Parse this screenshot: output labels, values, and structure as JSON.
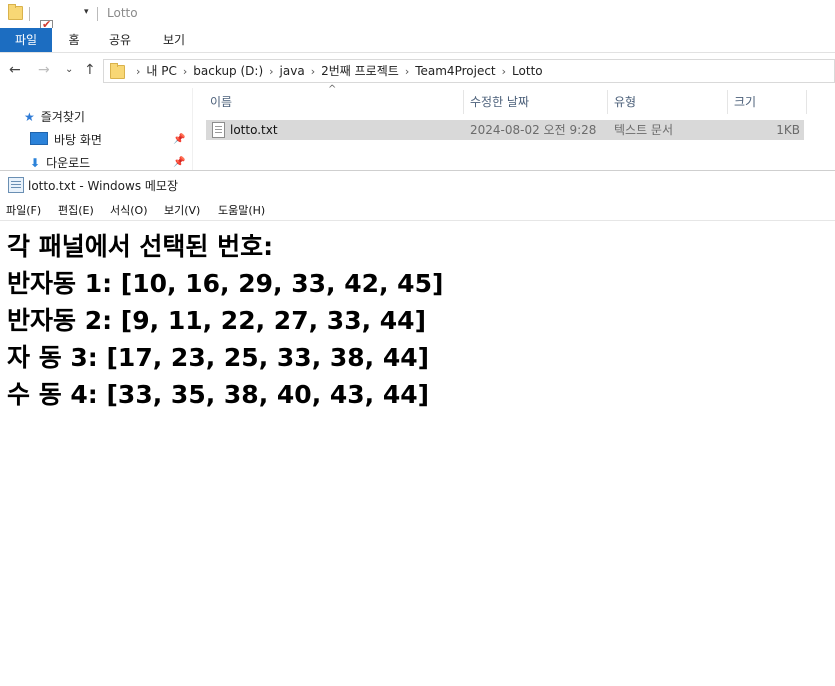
{
  "explorer": {
    "window_title": "Lotto",
    "ribbon_tabs": [
      "파일",
      "홈",
      "공유",
      "보기"
    ],
    "breadcrumbs": [
      "내 PC",
      "backup (D:)",
      "java",
      "2번째 프로젝트",
      "Team4Project",
      "Lotto"
    ],
    "nav_items": [
      {
        "label": "즐겨찾기",
        "icon": "star-icon"
      },
      {
        "label": "바탕 화면",
        "icon": "desktop-icon"
      },
      {
        "label": "다운로드",
        "icon": "download-icon"
      }
    ],
    "columns": [
      "이름",
      "수정한 날짜",
      "유형",
      "크기"
    ],
    "files": [
      {
        "name": "lotto.txt",
        "modified": "2024-08-02 오전 9:28",
        "type": "텍스트 문서",
        "size": "1KB"
      }
    ]
  },
  "notepad": {
    "title": "lotto.txt - Windows 메모장",
    "menu": [
      "파일(F)",
      "편집(E)",
      "서식(O)",
      "보기(V)",
      "도움말(H)"
    ],
    "lines": [
      "각 패널에서 선택된 번호:",
      "반자동 1: [10, 16, 29, 33, 42, 45]",
      "반자동 2: [9, 11, 22, 27, 33, 44]",
      "자 동 3: [17, 23, 25, 33, 38, 44]",
      "수 동 4: [33, 35, 38, 40, 43, 44]"
    ]
  },
  "colors": {
    "ribbon_file_tab": "#1c6dc1",
    "selected_row": "#d9d9d9",
    "folder": "#f8d775"
  }
}
